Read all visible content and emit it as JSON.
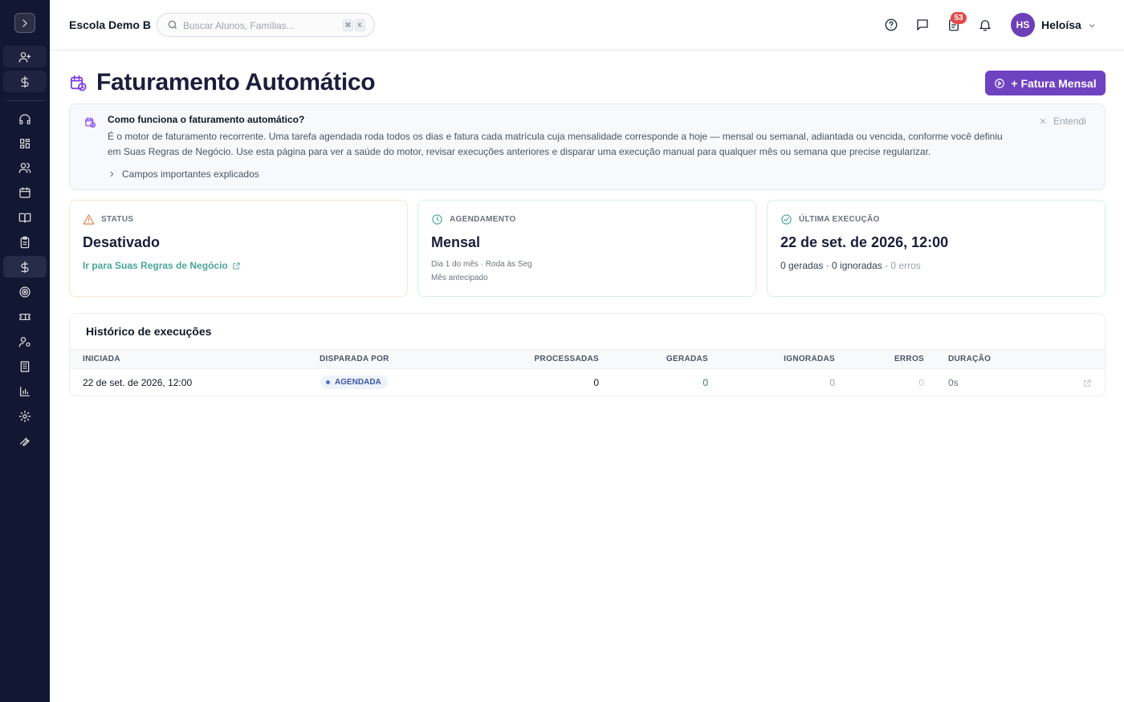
{
  "header": {
    "school_name": "Escola Demo B",
    "search_placeholder": "Buscar Alunos, Famílias...",
    "shortcut_keys": [
      "⌘",
      "K"
    ],
    "tasks_badge": "53",
    "user_initials": "HS",
    "user_name": "Heloísa"
  },
  "page": {
    "title": "Faturamento Automático",
    "primary_action": "+ Fatura Mensal"
  },
  "info_panel": {
    "title": "Como funciona o faturamento automático?",
    "body": "É o motor de faturamento recorrente. Uma tarefa agendada roda todos os dias e fatura cada matrícula cuja mensalidade corresponde a hoje — mensal ou semanal, adiantada ou vencida, conforme você definiu em Suas Regras de Negócio. Use esta página para ver a saúde do motor, revisar execuções anteriores e disparar uma execução manual para qualquer mês ou semana que precise regularizar.",
    "dismiss_label": "Entendi",
    "expand_label": "Campos importantes explicados"
  },
  "cards": {
    "status": {
      "label": "STATUS",
      "value": "Desativado",
      "link": "Ir para Suas Regras de Negócio"
    },
    "schedule": {
      "label": "AGENDAMENTO",
      "value": "Mensal",
      "detail1": "Dia 1 do mês · Roda às Seg",
      "detail2": "Mês antecipado"
    },
    "last_run": {
      "label": "ÚLTIMA EXECUÇÃO",
      "value": "22 de set. de 2026, 12:00",
      "stats": "0 geradas · 0 ignoradas · ",
      "errors": "0 erros"
    }
  },
  "history": {
    "title": "Histórico de execuções",
    "columns": [
      "INICIADA",
      "DISPARADA POR",
      "PROCESSADAS",
      "GERADAS",
      "IGNORADAS",
      "ERROS",
      "DURAÇÃO"
    ],
    "rows": [
      {
        "started": "22 de set. de 2026, 12:00",
        "triggered_by": "AGENDADA",
        "processed": "0",
        "generated": "0",
        "ignored": "0",
        "errors": "0",
        "duration": "0s"
      }
    ]
  },
  "colors": {
    "sidebar_bg": "#131832",
    "primary": "#6f42c1",
    "accent_link": "#4ba59a",
    "warning": "#e07a3a",
    "success": "#4ba59a",
    "badge": "#e34a4a",
    "title": "#1c1d3b"
  },
  "icons": {
    "sidebar": [
      "chevron-right-icon",
      "user-plus-icon",
      "dollar-icon",
      "headset-icon",
      "grid-icon",
      "users-icon",
      "calendar-icon",
      "book-icon",
      "clipboard-icon",
      "dollar-icon",
      "target-icon",
      "ticket-icon",
      "user-cog-icon",
      "building-icon",
      "bar-chart-icon",
      "settings-icon",
      "wrench-icon"
    ],
    "header": [
      "help-icon",
      "message-icon",
      "tasks-icon",
      "bell-icon",
      "chevron-down-icon"
    ]
  }
}
